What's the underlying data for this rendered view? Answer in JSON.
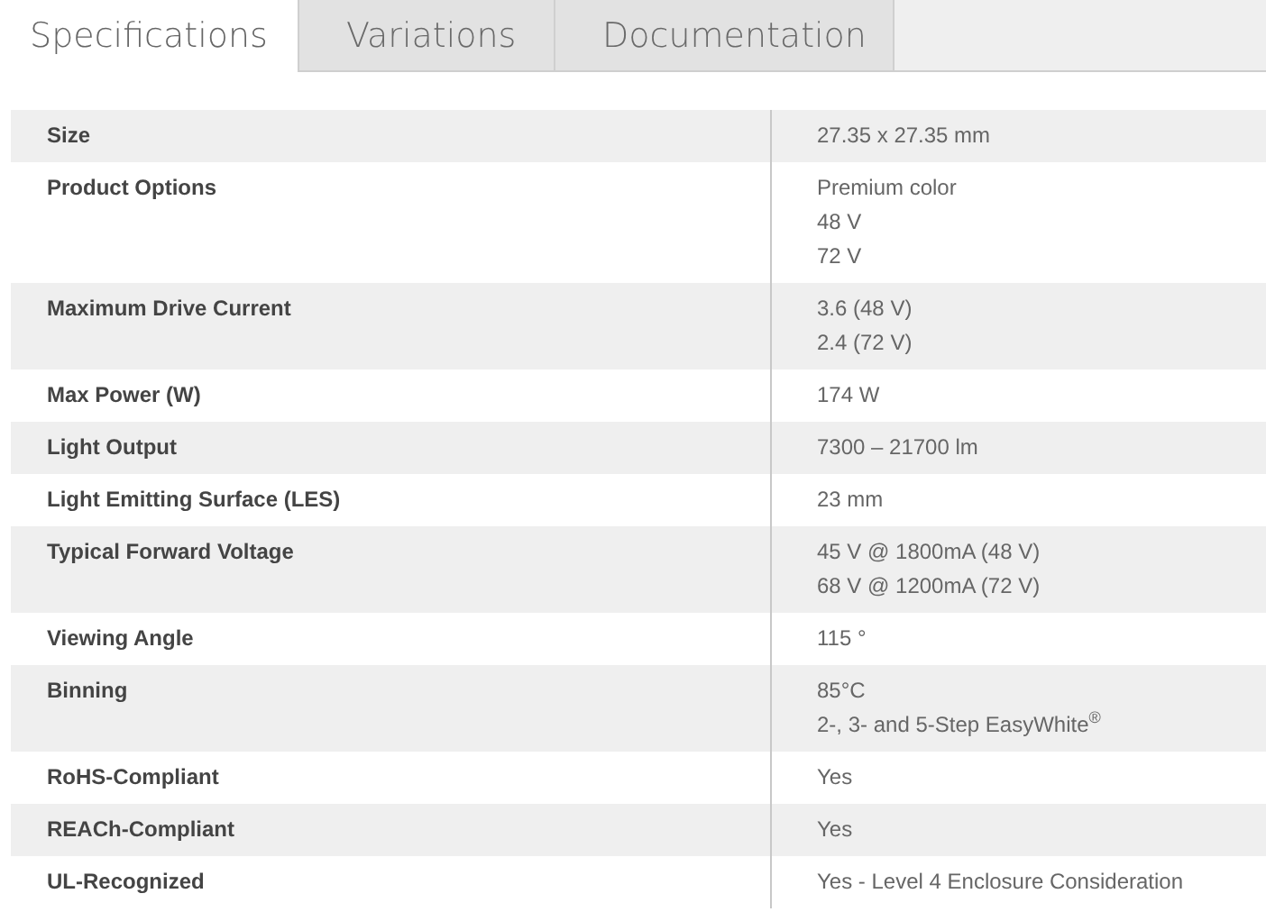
{
  "tabs": [
    {
      "label": "Specifications",
      "selected": true
    },
    {
      "label": "Variations",
      "selected": false
    },
    {
      "label": "Documentation",
      "selected": false
    }
  ],
  "specs": [
    {
      "label": "Size",
      "values": [
        "27.35 x 27.35 mm"
      ]
    },
    {
      "label": "Product Options",
      "values": [
        "Premium color",
        "48 V",
        "72 V"
      ]
    },
    {
      "label": "Maximum Drive Current",
      "values": [
        "3.6 (48 V)",
        "2.4 (72 V)"
      ]
    },
    {
      "label": "Max Power (W)",
      "values": [
        "174 W"
      ]
    },
    {
      "label": "Light Output",
      "values": [
        "7300 – 21700 lm"
      ]
    },
    {
      "label": "Light Emitting Surface (LES)",
      "values": [
        "23 mm"
      ]
    },
    {
      "label": "Typical Forward Voltage",
      "values": [
        "45 V @ 1800mA (48 V)",
        "68 V @ 1200mA (72 V)"
      ]
    },
    {
      "label": "Viewing Angle",
      "values": [
        "115 °"
      ]
    },
    {
      "label": "Binning",
      "values": [
        "85°C",
        "2-, 3- and 5-Step EasyWhite$^{®}$"
      ]
    },
    {
      "label": "RoHS-Compliant",
      "values": [
        "Yes"
      ]
    },
    {
      "label": "REACh-Compliant",
      "values": [
        "Yes"
      ]
    },
    {
      "label": "UL-Recognized",
      "values": [
        "Yes - Level 4 Enclosure Consideration"
      ]
    }
  ]
}
